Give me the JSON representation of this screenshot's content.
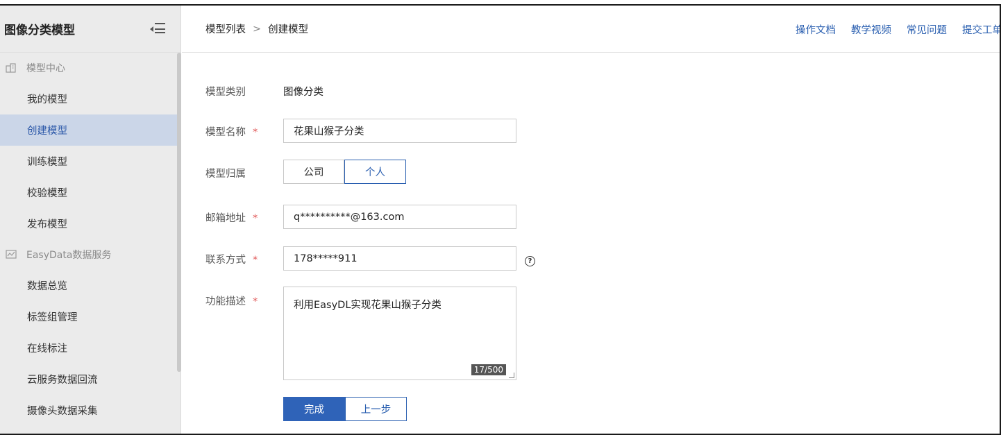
{
  "sidebar": {
    "title": "图像分类模型",
    "groups": [
      {
        "label": "模型中心",
        "icon": "building-icon",
        "items": [
          {
            "label": "我的模型",
            "active": false
          },
          {
            "label": "创建模型",
            "active": true
          },
          {
            "label": "训练模型",
            "active": false
          },
          {
            "label": "校验模型",
            "active": false
          },
          {
            "label": "发布模型",
            "active": false
          }
        ]
      },
      {
        "label": "EasyData数据服务",
        "icon": "chart-icon",
        "items": [
          {
            "label": "数据总览",
            "active": false
          },
          {
            "label": "标签组管理",
            "active": false
          },
          {
            "label": "在线标注",
            "active": false
          },
          {
            "label": "云服务数据回流",
            "active": false
          },
          {
            "label": "摄像头数据采集",
            "active": false
          }
        ]
      }
    ]
  },
  "header": {
    "breadcrumb": [
      "模型列表",
      "创建模型"
    ],
    "separator": ">",
    "links": [
      "操作文档",
      "教学视频",
      "常见问题",
      "提交工单"
    ]
  },
  "form": {
    "category_label": "模型类别",
    "category_value": "图像分类",
    "name_label": "模型名称",
    "name_value": "花果山猴子分类",
    "owner_label": "模型归属",
    "owner_options": [
      "公司",
      "个人"
    ],
    "owner_selected": "个人",
    "email_label": "邮箱地址",
    "email_value": "q**********@163.com",
    "phone_label": "联系方式",
    "phone_value": "178*****911",
    "desc_label": "功能描述",
    "desc_value": "利用EasyDL实现花果山猴子分类",
    "desc_counter": "17/500",
    "required_mark": "*",
    "help_glyph": "?",
    "submit_label": "完成",
    "back_label": "上一步"
  },
  "colors": {
    "accent": "#2f63b8",
    "active_bg": "#cbd6e8",
    "required": "#e05656"
  }
}
